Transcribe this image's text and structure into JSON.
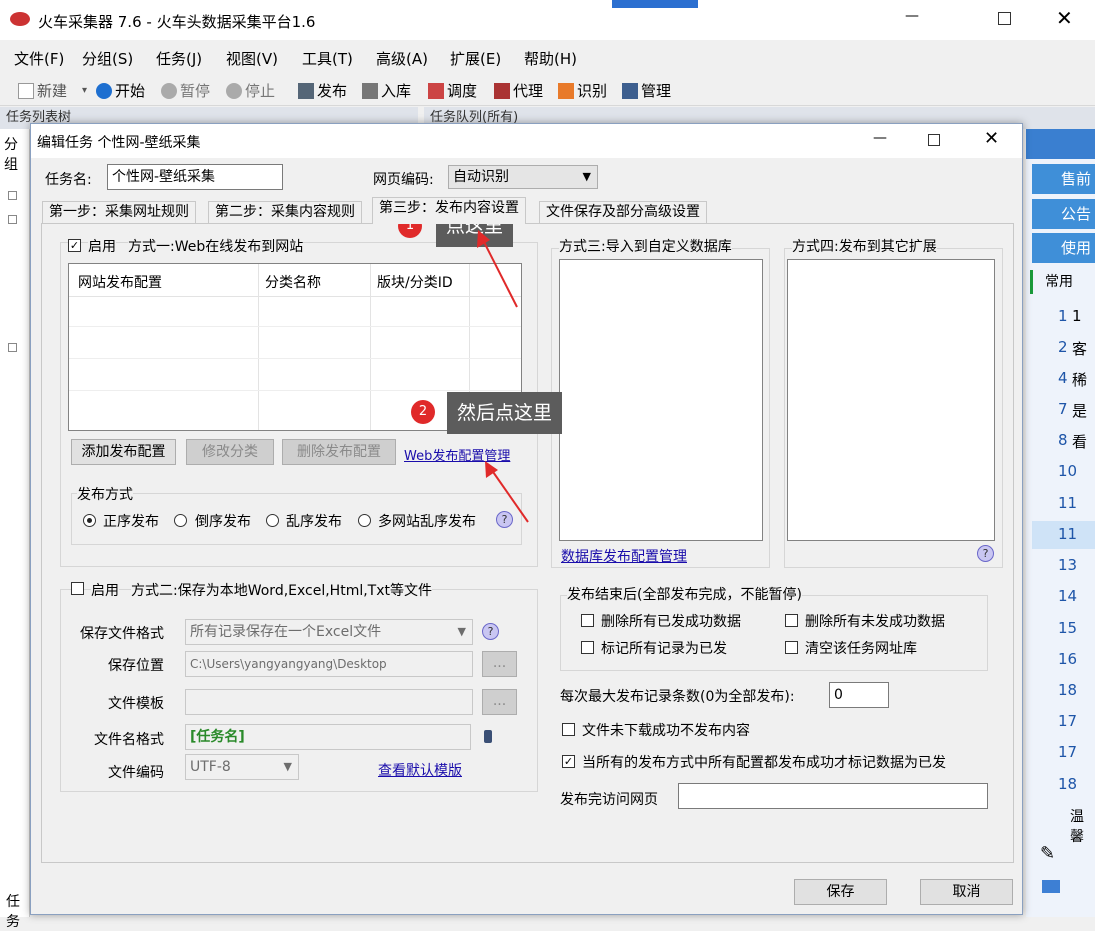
{
  "app": {
    "title": "火车采集器 7.6 - 火车头数据采集平台1.6",
    "menu": [
      "文件(F)",
      "分组(S)",
      "任务(J)",
      "视图(V)",
      "工具(T)",
      "高级(A)",
      "扩展(E)",
      "帮助(H)"
    ],
    "toolbar": [
      "新建",
      "开始",
      "暂停",
      "停止",
      "发布",
      "入库",
      "调度",
      "代理",
      "识别",
      "管理"
    ],
    "left_pane_title": "任务列表树",
    "left_pane_tab": "分组",
    "queue_pane_title": "任务队列(所有)",
    "status_left": "任务"
  },
  "right_panel": {
    "buttons": [
      "售前",
      "公告",
      "使用"
    ],
    "section": "常用",
    "numbers": [
      "1",
      "2",
      "4",
      "7",
      "8",
      "10",
      "11",
      "11",
      "13",
      "14",
      "15",
      "16",
      "18",
      "17",
      "17",
      "18"
    ],
    "num_suffix": [
      "1",
      "客",
      "稀",
      "是",
      "看",
      "",
      "",
      "",
      "",
      "",
      "",
      "",
      "",
      "",
      "",
      ""
    ],
    "footer": "温馨"
  },
  "dialog": {
    "title": "编辑任务 个性网-壁纸采集",
    "task_name_label": "任务名:",
    "task_name_value": "个性网-壁纸采集",
    "encoding_label": "网页编码:",
    "encoding_value": "自动识别",
    "tabs": [
      "第一步：采集网址规则",
      "第二步：采集内容规则",
      "第三步：发布内容设置",
      "文件保存及部分高级设置"
    ],
    "method1": {
      "enable_label": "启用",
      "title": "方式一:Web在线发布到网站",
      "columns": [
        "网站发布配置",
        "分类名称",
        "版块/分类ID"
      ],
      "btn_add": "添加发布配置",
      "btn_edit": "修改分类",
      "btn_delete": "删除发布配置",
      "link_manage": "Web发布配置管理",
      "publish_mode_title": "发布方式",
      "modes": [
        "正序发布",
        "倒序发布",
        "乱序发布",
        "多网站乱序发布"
      ]
    },
    "method2": {
      "enable_label": "启用",
      "title": "方式二:保存为本地Word,Excel,Html,Txt等文件",
      "format_label": "保存文件格式",
      "format_value": "所有记录保存在一个Excel文件",
      "location_label": "保存位置",
      "location_value": "C:\\Users\\yangyangyang\\Desktop",
      "template_label": "文件模板",
      "template_value": "",
      "filename_label": "文件名格式",
      "filename_value": "[任务名]",
      "encoding_label": "文件编码",
      "encoding_value": "UTF-8",
      "link_default": "查看默认模版",
      "browse": "..."
    },
    "method3": {
      "title": "方式三:导入到自定义数据库",
      "link": "数据库发布配置管理"
    },
    "method4": {
      "title": "方式四:发布到其它扩展"
    },
    "after_publish": {
      "title": "发布结束后(全部发布完成，不能暂停)",
      "opts": [
        "删除所有已发成功数据",
        "删除所有未发成功数据",
        "标记所有记录为已发",
        "清空该任务网址库"
      ]
    },
    "max_records_label": "每次最大发布记录条数(0为全部发布):",
    "max_records_value": "0",
    "no_publish_label": "文件未下载成功不发布内容",
    "all_success_label": "当所有的发布方式中所有配置都发布成功才标记数据为已发",
    "visit_label": "发布完访问网页",
    "save": "保存",
    "cancel": "取消"
  },
  "annotations": [
    {
      "n": "1",
      "text": "点这里"
    },
    {
      "n": "2",
      "text": "然后点这里"
    }
  ]
}
